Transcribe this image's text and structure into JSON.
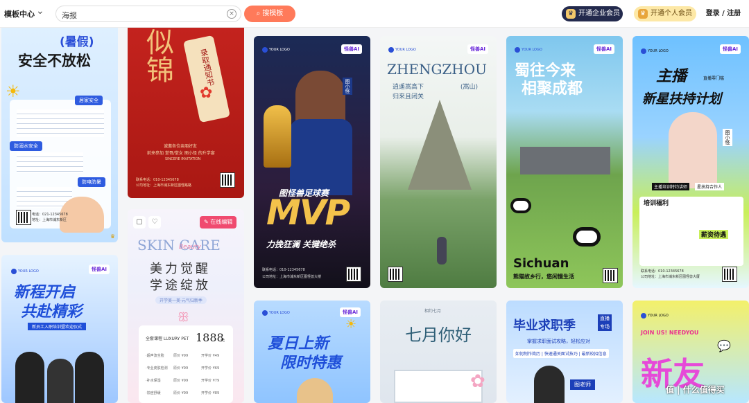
{
  "topbar": {
    "brand": "模板中心",
    "search_value": "海报",
    "search_button": "搜模板",
    "vip_enterprise": "开通企业会员",
    "vip_personal": "开通个人会员",
    "login": "登录 / 注册"
  },
  "cards": {
    "summer_safety": {
      "badge": "(暑假)",
      "title": "安全不放松",
      "tag1": "居家安全",
      "tag2": "防溺水安全",
      "tag3": "防电防暑",
      "phone": "电话：021-12345678",
      "addr": "地址：上海市浦东新区"
    },
    "admission": {
      "title": "似锦",
      "scroll_text": "录取通知书",
      "line1": "诚邀各位亲朋好友",
      "line2": "前来参加 堂哥/堂女 图小怪 的升学宴",
      "line3": "SINCERE INVITATION",
      "contact1": "联系电话：010-12345678",
      "contact2": "公司地址：上海市浦东新区图怪路路"
    },
    "mvp": {
      "logo": "YOUR LOGO",
      "ai": "怪兽AI",
      "event": "图怪兽足球赛",
      "title": "MVP",
      "slogan": "力挽狂澜 关键绝杀",
      "contact1": "联系电话：010-12345678",
      "contact2": "公司地址：上海市浦东新区图怪兽大楼",
      "name_tag": "图小怪"
    },
    "zhengzhou": {
      "logo": "YOUR LOGO",
      "ai": "怪兽AI",
      "title": "ZHENGZHOU",
      "poem1": "逍遥嵩高下",
      "poem2": "归来且闭关",
      "mountain": "(嵩山)"
    },
    "chengdu": {
      "logo": "YOUR LOGO",
      "ai": "怪兽AI",
      "title1": "蜀往今来",
      "title2": "相聚成都",
      "en": "Sichuan",
      "slogan": "熊猫故乡行，悠闲慢生活"
    },
    "anchor": {
      "logo": "YOUR LOGO",
      "ai": "怪兽AI",
      "title1": "主播",
      "title2": "新星扶持计划",
      "tag": "直播零门槛",
      "benefit1": "主播培训特约讲师",
      "benefit2": "星扶持合作人",
      "sec1": "培训福利",
      "sec2": "薪资待遇",
      "contact1": "联系电话：010-12345678",
      "contact2": "公司地址：上海市浦东新区图怪兽大厦",
      "name_tag": "图小怪"
    },
    "new_journey": {
      "logo": "YOUR LOGO",
      "ai": "怪兽AI",
      "title1": "新程开启",
      "title2": "共赴精彩",
      "sub": "新员工入职培训暨欢迎仪式"
    },
    "skincare": {
      "edit": "在线编辑",
      "title": "SKIN CARE",
      "script": "Beauty",
      "cn1": "美力觉醒",
      "cn2": "学途绽放",
      "promo": "开学美一美·元气归新季",
      "course_label": "全套课程 LUXURY PET",
      "price": "1888",
      "price_unit": "元",
      "items": [
        {
          "name": "·超声波全脸",
          "p1": "原价 ¥99",
          "p2": "开学价 ¥49"
        },
        {
          "name": "·专业皮肤检测",
          "p1": "原价 ¥99",
          "p2": "开学价 ¥69"
        },
        {
          "name": "·补水保湿",
          "p1": "原价 ¥99",
          "p2": "开学价 ¥79"
        },
        {
          "name": "·祛痘舒缓",
          "p1": "原价 ¥99",
          "p2": "开学价 ¥89"
        }
      ]
    },
    "summer_sale": {
      "logo": "YOUR LOGO",
      "ai": "怪兽AI",
      "title1": "夏日上新",
      "title2": "限时特惠"
    },
    "july": {
      "top": "相约七月",
      "title": "七月你好"
    },
    "graduate": {
      "title": "毕业求职季",
      "tag1": "直播",
      "tag2": "专场",
      "sub": "掌握求职面试攻略，轻松应对",
      "list": "如何制作简历 | 快速通关面试技巧 | 最新校招信息",
      "teacher": "图老师"
    },
    "join": {
      "logo": "YOUR LOGO",
      "slogan": "JOIN US! NEEDYOU",
      "title": "新友"
    }
  },
  "watermark": "值 | 什么值得买"
}
